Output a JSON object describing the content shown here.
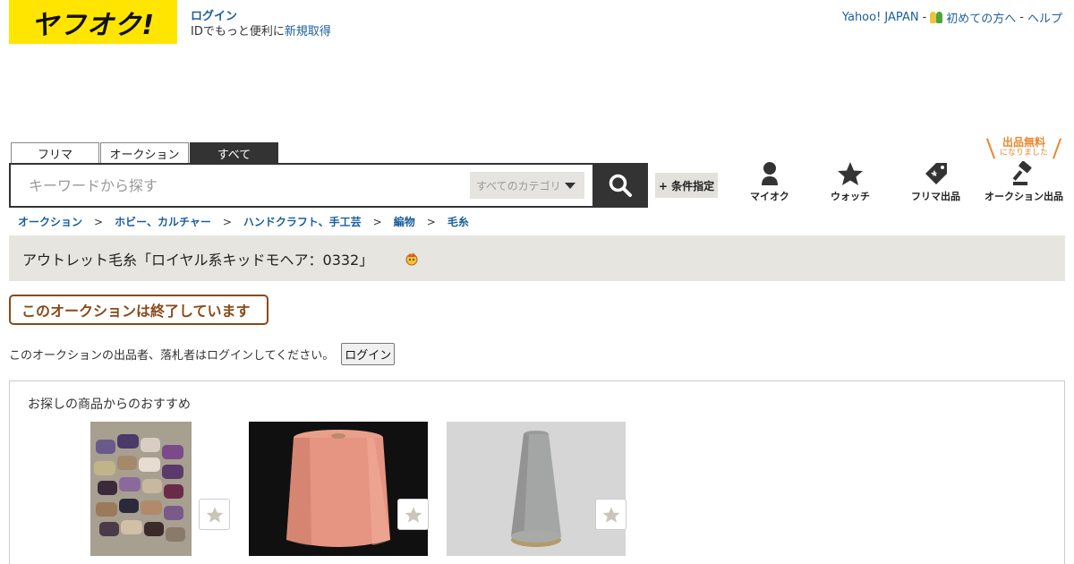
{
  "header": {
    "logo_text": "ヤフオク!",
    "login_label": "ログイン",
    "login_sub_prefix": "IDでもっと便利に",
    "register_label": "新規取得",
    "links": {
      "yahoo_japan": "Yahoo! JAPAN",
      "beginners": "初めての方へ",
      "help": "ヘルプ",
      "separator": "-"
    }
  },
  "search": {
    "tabs": [
      {
        "label": "フリマ",
        "active": false
      },
      {
        "label": "オークション",
        "active": false
      },
      {
        "label": "すべて",
        "active": true
      }
    ],
    "placeholder": "キーワードから探す",
    "category_selected": "すべてのカテゴリ",
    "condition_button": "+ 条件指定"
  },
  "nav": {
    "free_banner_title": "出品無料",
    "free_banner_sub": "になりました",
    "items": [
      {
        "label": "マイオク",
        "icon": "person-icon"
      },
      {
        "label": "ウォッチ",
        "icon": "star-icon"
      },
      {
        "label": "フリマ出品",
        "icon": "price-tag-icon"
      },
      {
        "label": "オークション出品",
        "icon": "gavel-icon"
      }
    ]
  },
  "breadcrumb": {
    "items": [
      "オークション",
      "ホビー、カルチャー",
      "ハンドクラフト、手工芸",
      "編物",
      "毛糸"
    ],
    "separator": ">"
  },
  "item": {
    "title": "アウトレット毛糸「ロイヤル系キッドモヘア：0332」"
  },
  "status": {
    "ended_label": "このオークションは終了しています",
    "login_note": "このオークションの出品者、落札者はログインしてください。",
    "login_button": "ログイン"
  },
  "recommend": {
    "heading": "お探しの商品からのおすすめ",
    "products": [
      {
        "image": "yarn-skeins-basket-photo"
      },
      {
        "image": "salmon-yarn-cone-photo"
      },
      {
        "image": "gray-yarn-cone-photo"
      }
    ]
  },
  "colors": {
    "brand_yellow": "#ffe500",
    "link_blue": "#1b5f9c",
    "ended_brown": "#8a4a19",
    "title_bar_bg": "#e6e5df",
    "free_orange": "#e8892f"
  }
}
